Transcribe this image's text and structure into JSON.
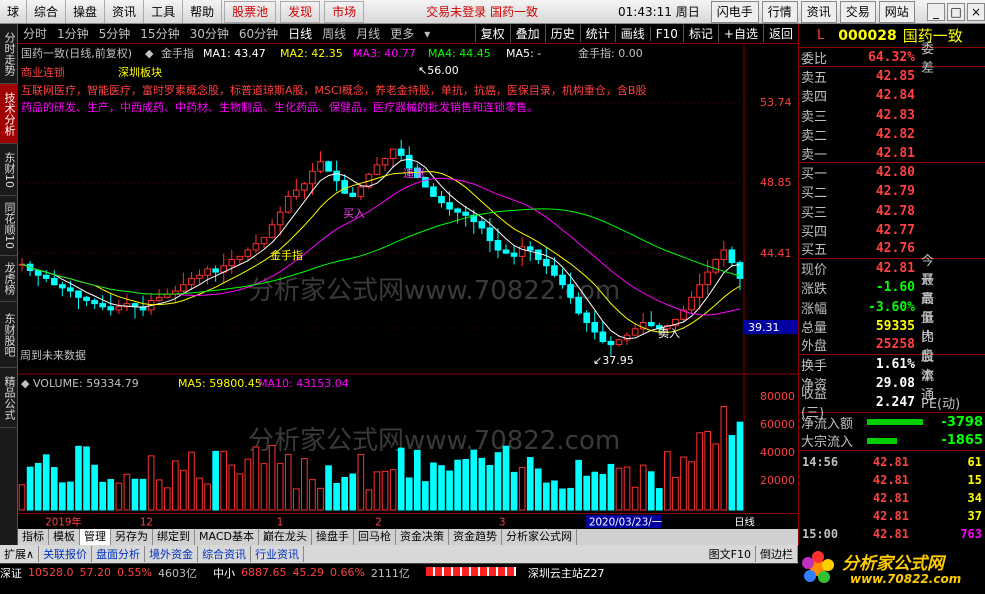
{
  "menubar": {
    "items": [
      "球",
      "综合",
      "操盘",
      "资讯",
      "工具",
      "帮助"
    ],
    "highlight": [
      "股票池",
      "发现",
      "市场"
    ],
    "status": "交易未登录",
    "stock_title": "国药一致",
    "clock": "01:43:11 周日",
    "right_buttons": [
      "闪电手",
      "行情",
      "资讯",
      "交易",
      "网站"
    ]
  },
  "lefttabs": [
    "分时走势",
    "技术分析",
    "东财10",
    "同花顺10",
    "龙虎榜",
    "东财股吧",
    "精品公式"
  ],
  "periodbar": {
    "periods": [
      "分时",
      "1分钟",
      "5分钟",
      "15分钟",
      "30分钟",
      "60分钟",
      "日线",
      "周线",
      "月线",
      "更多"
    ],
    "tools": [
      "复权",
      "叠加",
      "历史",
      "统计",
      "画线",
      "F10",
      "标记",
      "+自选",
      "返回"
    ]
  },
  "chart": {
    "header": {
      "title": "国药一致(日线,前复权)",
      "indicator": "金手指",
      "ma": [
        {
          "label": "MA1: 43.47",
          "color": "#ffffff"
        },
        {
          "label": "MA2: 42.35",
          "color": "#ffff00"
        },
        {
          "label": "MA3: 40.77",
          "color": "#ff00ff"
        },
        {
          "label": "MA4: 44.45",
          "color": "#00ff00"
        },
        {
          "label": "MA5: -",
          "color": "#ffffff"
        }
      ],
      "gold": "金手指: 0.00"
    },
    "concepts_line1_a": "商业连锁",
    "concepts_line1_b": "深圳板块",
    "concepts_line2": "互联网医疗，智能医疗，富时罗素概念股，标普道琼斯A股，MSCI概念，养老金持股，单抗，抗癌，医保目录，机构重仓，含B股",
    "concepts_line3": "药品的研发、生产，中西成药、中药材、生物制品、生化药品、保健品，医疗器械的批发销售和连锁零售。",
    "y_labels": [
      "53.74",
      "48.85",
      "44.41",
      "39.31"
    ],
    "high_label": "56.00",
    "low_label": "37.95",
    "annotations": [
      "追涨",
      "买入",
      "卖入",
      "金手指"
    ],
    "future_text": "周到未来数据",
    "watermark": "分析家公式网www.70822.com",
    "vol_header": {
      "vol": "VOLUME: 59334.79",
      "ma5": "MA5: 59800.45",
      "ma10": "MA10: 43153.04"
    },
    "vol_labels": [
      "80000",
      "60000",
      "40000",
      "20000"
    ],
    "x_labels": [
      "2019年",
      "12",
      "1",
      "2",
      "3"
    ],
    "date_cursor": "2020/03/23/一",
    "period_label": "日线"
  },
  "bottomtabs": [
    "指标",
    "模板",
    "管理",
    "另存为",
    "绑定到",
    "MACD基本",
    "巅在龙头",
    "操盘手",
    "回马枪",
    "资金决策",
    "资金趋势",
    "分析家公式网"
  ],
  "bottomtabs2": {
    "items": [
      "扩展∧",
      "关联报价",
      "盘面分析",
      "境外资金",
      "综合资讯",
      "行业资讯"
    ],
    "right": [
      "图文F10",
      "倒边栏"
    ]
  },
  "statusbar": {
    "sz_label": "深证",
    "sz_val": "10528.0",
    "sz_chg": "57.20",
    "sz_pct": "0.55%",
    "sz_amt": "4603亿",
    "zx_label": "中小",
    "zx_val": "6887.65",
    "zx_chg": "45.29",
    "zx_pct": "0.66%",
    "zx_amt": "2111亿",
    "site": "深圳云主站Z27"
  },
  "quote": {
    "flag": "L",
    "code": "000028",
    "name": "国药一致",
    "weibi": "委比",
    "weibi_val": "64.32%",
    "weicha": "委差",
    "sells": [
      [
        "卖五",
        "42.85"
      ],
      [
        "卖四",
        "42.84"
      ],
      [
        "卖三",
        "42.83"
      ],
      [
        "卖二",
        "42.82"
      ],
      [
        "卖一",
        "42.81"
      ]
    ],
    "buys": [
      [
        "买一",
        "42.80"
      ],
      [
        "买二",
        "42.79"
      ],
      [
        "买三",
        "42.78"
      ],
      [
        "买四",
        "42.77"
      ],
      [
        "买五",
        "42.76"
      ]
    ],
    "stats": [
      [
        "现价",
        "42.81",
        "今开"
      ],
      [
        "涨跌",
        "-1.60",
        "最高"
      ],
      [
        "涨幅",
        "-3.60%",
        "最低"
      ],
      [
        "总量",
        "59335",
        "量比"
      ],
      [
        "外盘",
        "25258",
        "内盘"
      ]
    ],
    "stats2": [
      [
        "换手",
        "1.61%",
        "股本"
      ],
      [
        "净资",
        "29.08",
        "流通"
      ],
      [
        "收益(三)",
        "2.247",
        "PE(动)"
      ]
    ],
    "flows": [
      [
        "净流入额",
        "-3798"
      ],
      [
        "大宗流入",
        "-1865"
      ]
    ],
    "ticks": [
      [
        "14:56",
        "42.81",
        "61"
      ],
      [
        "",
        "42.81",
        "15"
      ],
      [
        "",
        "42.81",
        "34"
      ],
      [
        "",
        "42.81",
        "37"
      ],
      [
        "15:00",
        "42.81",
        "763"
      ]
    ]
  },
  "logo": {
    "text": "分析家公式网",
    "url": "www.70822.com"
  }
}
